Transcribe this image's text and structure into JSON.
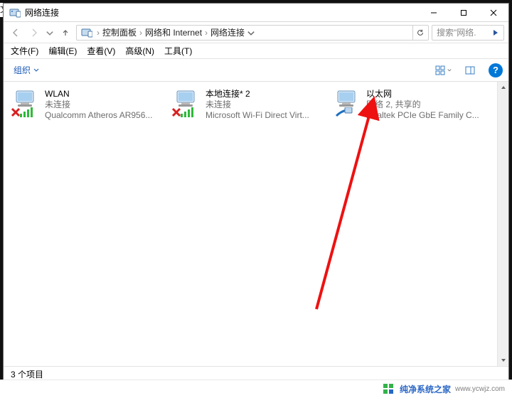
{
  "window": {
    "title": "网络连接",
    "min_tip": "最小化",
    "max_tip": "最大化",
    "close_tip": "关闭"
  },
  "nav": {
    "back_tip": "后退",
    "forward_tip": "前进",
    "up_tip": "上移一级",
    "refresh_tip": "刷新",
    "breadcrumb": [
      "控制面板",
      "网络和 Internet",
      "网络连接"
    ],
    "search_placeholder": "搜索\"网络..."
  },
  "menu": {
    "items": [
      "文件(F)",
      "编辑(E)",
      "查看(V)",
      "高级(N)",
      "工具(T)"
    ]
  },
  "toolbar": {
    "organize_label": "组织",
    "view_tip": "更改视图",
    "preview_tip": "显示预览窗格",
    "help_tip": "帮助"
  },
  "connections": [
    {
      "name": "WLAN",
      "status": "未连接",
      "device": "Qualcomm Atheros AR956...",
      "icon": "wifi-disabled"
    },
    {
      "name": "本地连接* 2",
      "status": "未连接",
      "device": "Microsoft Wi-Fi Direct Virt...",
      "icon": "wifi-disabled"
    },
    {
      "name": "以太网",
      "status": "网络 2, 共享的",
      "device": "Realtek PCIe GbE Family C...",
      "icon": "ethernet"
    }
  ],
  "status": {
    "text": "3 个项目"
  },
  "watermark": {
    "brand": "纯净系统之家",
    "url": "www.ycwjz.com"
  }
}
